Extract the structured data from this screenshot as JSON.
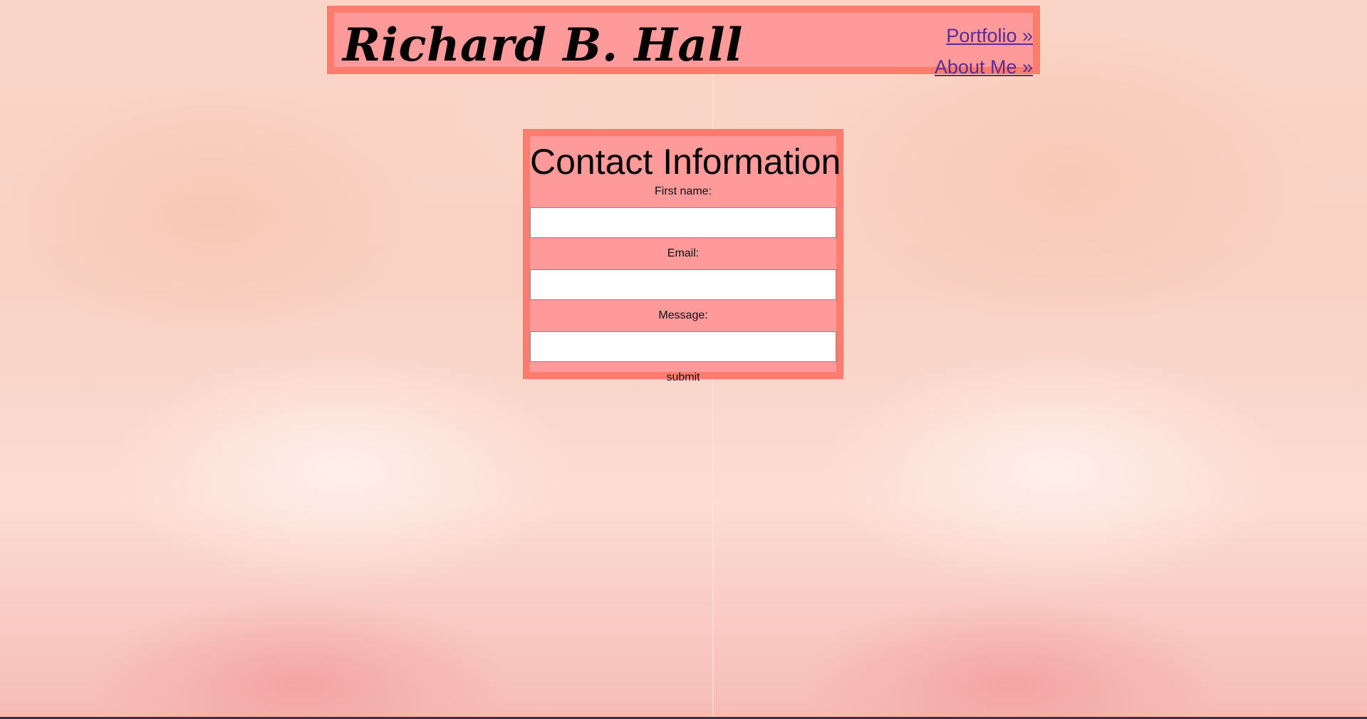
{
  "header": {
    "site_title": "Richard B. Hall",
    "nav": [
      {
        "label": "Portfolio »"
      },
      {
        "label": "About Me »"
      }
    ]
  },
  "contact": {
    "heading": "Contact Information",
    "fields": {
      "first_name": {
        "label": "First name:",
        "value": "",
        "placeholder": ""
      },
      "email": {
        "label": "Email:",
        "value": "",
        "placeholder": ""
      },
      "message": {
        "label": "Message:",
        "value": "",
        "placeholder": ""
      }
    },
    "submit_label": "submit"
  },
  "colors": {
    "panel_background": "#fe9b9a",
    "panel_border": "#fd7c6d",
    "link": "#5b2b93",
    "page_background": "#fbd7cc"
  }
}
